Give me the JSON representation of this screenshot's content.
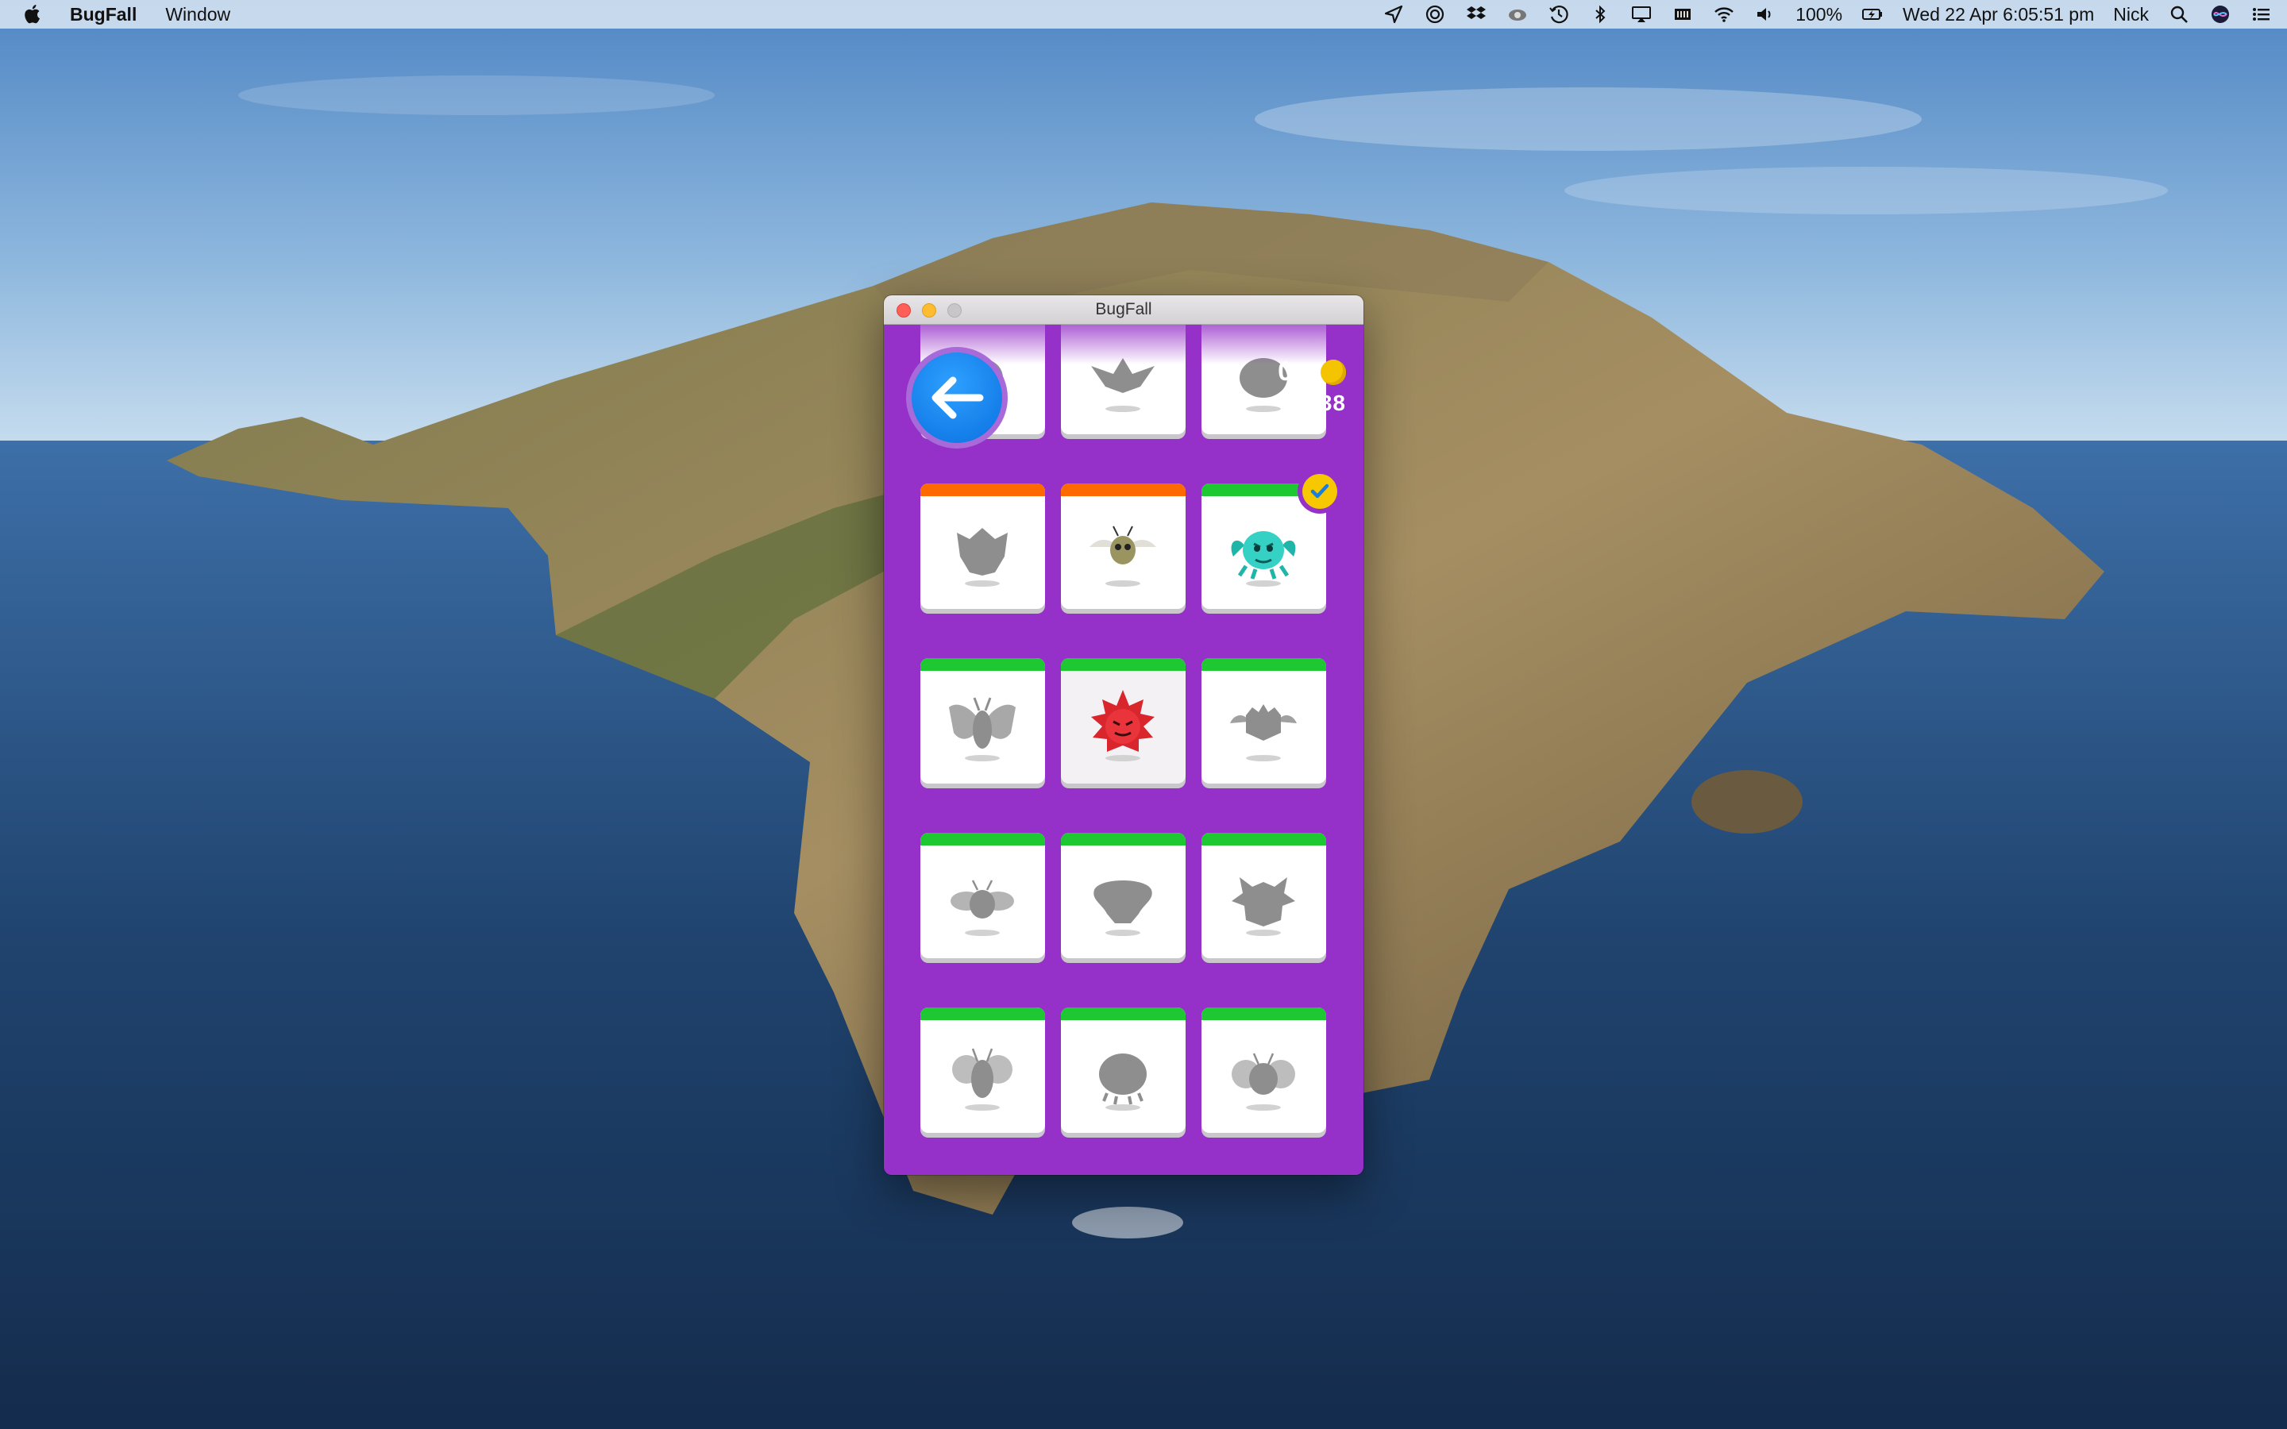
{
  "menubar": {
    "app_name": "BugFall",
    "menu_window": "Window",
    "battery_text": "100%",
    "clock": "Wed 22 Apr  6:05:51 pm",
    "user": "Nick"
  },
  "window": {
    "title": "BugFall"
  },
  "hud": {
    "coins": "0",
    "times": "x",
    "collected": "5/38"
  },
  "colors": {
    "background": "#9530c8",
    "band_orange": "#ff6a00",
    "band_green": "#1ec832",
    "back_button": "#0a84ff",
    "coin": "#f5c400"
  },
  "cards": [
    {
      "band": "none",
      "icon": "bug-silhouette-icon",
      "faded": true
    },
    {
      "band": "none",
      "icon": "winged-bug-silhouette-icon",
      "faded": true
    },
    {
      "band": "none",
      "icon": "round-bug-silhouette-icon",
      "faded": true
    },
    {
      "band": "orange",
      "icon": "furry-bug-silhouette-icon"
    },
    {
      "band": "orange",
      "icon": "moth-bug-icon"
    },
    {
      "band": "green",
      "icon": "teal-crab-bug-icon",
      "checked": true
    },
    {
      "band": "green",
      "icon": "moth-silhouette-icon"
    },
    {
      "band": "green",
      "icon": "red-spiky-bug-icon",
      "selected": true
    },
    {
      "band": "green",
      "icon": "fluffy-bug-silhouette-icon"
    },
    {
      "band": "green",
      "icon": "fly-silhouette-icon"
    },
    {
      "band": "green",
      "icon": "blob-bug-silhouette-icon"
    },
    {
      "band": "green",
      "icon": "horned-bug-silhouette-icon"
    },
    {
      "band": "green",
      "icon": "bee-silhouette-icon"
    },
    {
      "band": "green",
      "icon": "shell-bug-silhouette-icon"
    },
    {
      "band": "green",
      "icon": "fat-fly-silhouette-icon"
    }
  ]
}
